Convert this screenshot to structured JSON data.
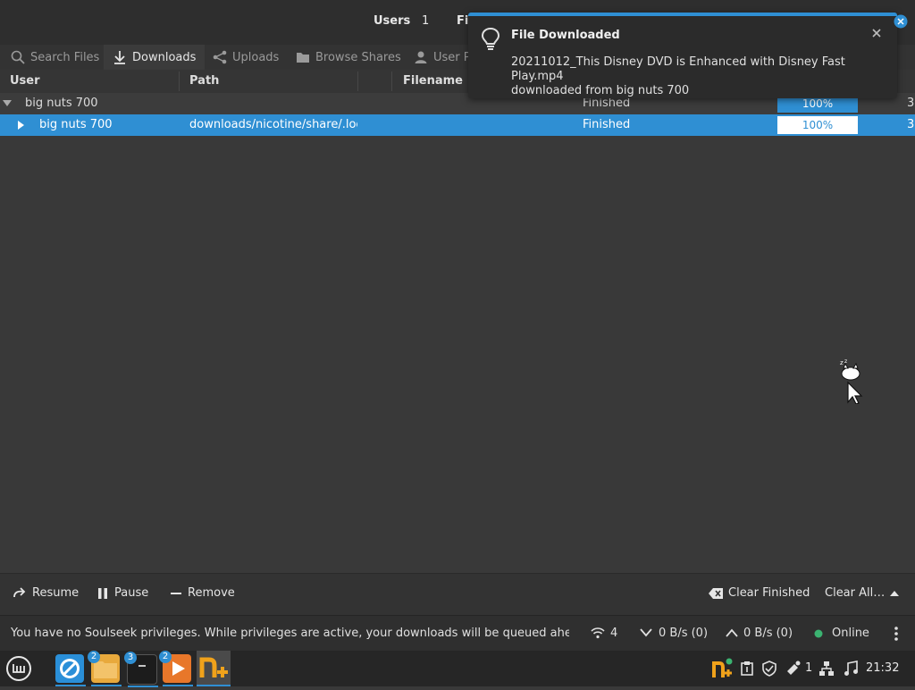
{
  "header": {
    "users_label": "Users",
    "users_count": "1",
    "files_label_partial": "Fil"
  },
  "tabs": [
    {
      "label": "Search Files",
      "icon": "search-icon"
    },
    {
      "label": "Downloads",
      "icon": "download-icon"
    },
    {
      "label": "Uploads",
      "icon": "share-icon"
    },
    {
      "label": "Browse Shares",
      "icon": "folder-icon"
    },
    {
      "label": "User P",
      "icon": "user-icon"
    }
  ],
  "columns": {
    "user": "User",
    "path": "Path",
    "filename": "Filename"
  },
  "rows": [
    {
      "user": "big nuts 700",
      "path": "",
      "status": "Finished",
      "progress": "100%",
      "extra": "3"
    },
    {
      "user": "big nuts 700",
      "path": "downloads/nicotine/share/.loca",
      "status": "Finished",
      "progress": "100%",
      "extra": "3"
    }
  ],
  "toolbar": {
    "resume": "Resume",
    "pause": "Pause",
    "remove": "Remove",
    "clear_finished": "Clear Finished",
    "clear_all": "Clear All…"
  },
  "status": {
    "message": "You have no Soulseek privileges. While privileges are active, your downloads will be queued ahead of …",
    "connections": "4",
    "down_speed": "0 B/s (0)",
    "up_speed": "0 B/s (0)",
    "online": "Online"
  },
  "notification": {
    "title": "File Downloaded",
    "line1": "20211012_This Disney DVD is Enhanced with Disney Fast Play.mp4",
    "line2": "downloaded from big nuts 700"
  },
  "taskbar": {
    "badges": [
      "2",
      "3",
      "2"
    ],
    "tray_count": "1",
    "clock": "21:32"
  },
  "colors": {
    "accent": "#2f8fd3",
    "online": "#3bb371"
  }
}
